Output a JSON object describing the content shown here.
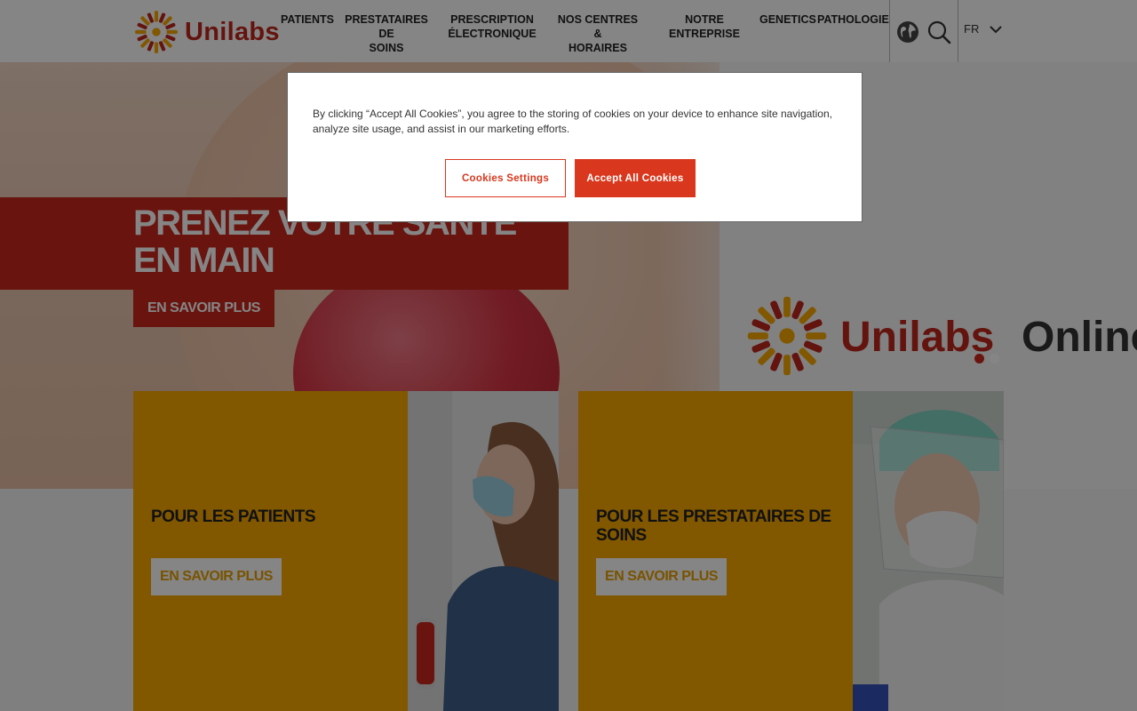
{
  "header": {
    "logo_text": "Unilabs",
    "nav": [
      {
        "line1": "PATIENTS",
        "line2": ""
      },
      {
        "line1": "PRESTATAIRES DE",
        "line2": "SOINS"
      },
      {
        "line1": "PRESCRIPTION",
        "line2": "ÉLECTRONIQUE"
      },
      {
        "line1": "NOS CENTRES &",
        "line2": "HORAIRES"
      },
      {
        "line1": "NOTRE",
        "line2": "ENTREPRISE"
      },
      {
        "line1": "GENETICS",
        "line2": ""
      },
      {
        "line1": "PATHOLOGIE",
        "line2": ""
      }
    ],
    "icons": {
      "globe": "globe-icon",
      "search": "search-icon",
      "chevron": "chevron-down-icon"
    },
    "language": "FR"
  },
  "hero": {
    "title": "PRENEZ VOTRE SANTÉ EN MAIN",
    "button": "EN SAVOIR PLUS",
    "brand_left": "Unilabs",
    "brand_right": "Online",
    "slide_count": 2,
    "active_slide": 1
  },
  "cards": [
    {
      "title": "POUR LES PATIENTS",
      "button": "EN SAVOIR PLUS"
    },
    {
      "title": "POUR LES PRESTATAIRES DE SOINS",
      "button": "EN SAVOIR PLUS"
    }
  ],
  "cookie_dialog": {
    "text": "By clicking “Accept All Cookies”, you agree to the storing of cookies on your device to enhance site navigation, analyze site usage, and assist in our marketing efforts.",
    "settings_button": "Cookies Settings",
    "accept_button": "Accept All Cookies"
  },
  "colors": {
    "brand_red": "#c9281c",
    "brand_orange": "#f7a800",
    "cookie_accent": "#d9381e",
    "overlay": "rgba(0,0,0,0.48)"
  }
}
